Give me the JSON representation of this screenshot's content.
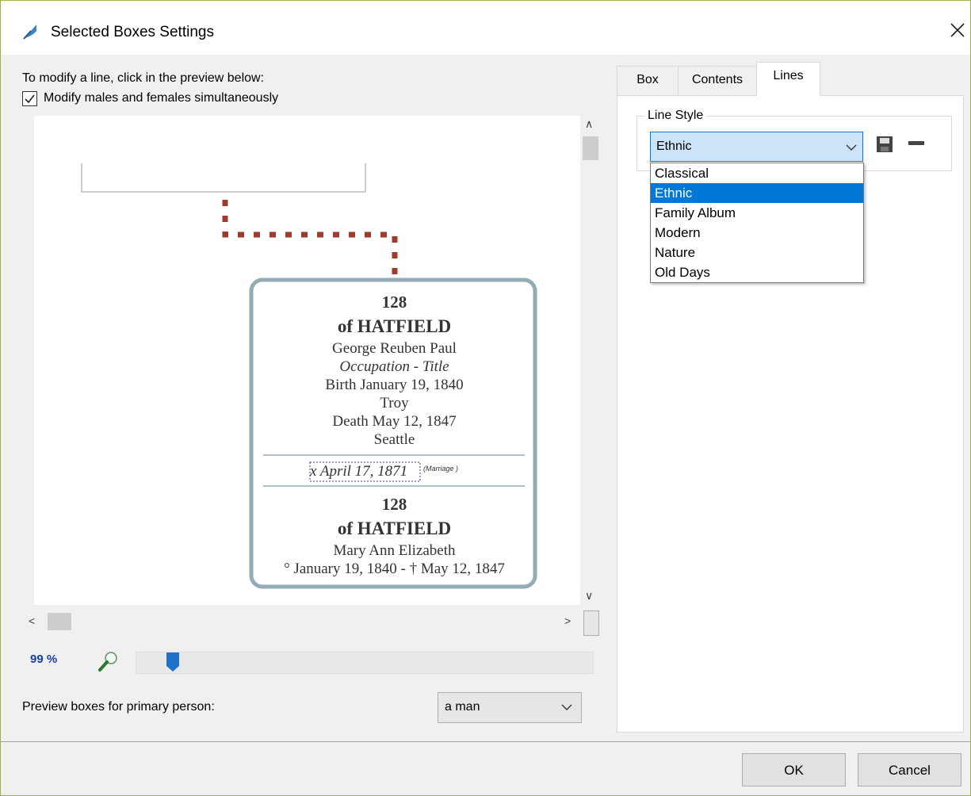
{
  "window": {
    "title": "Selected Boxes Settings"
  },
  "left": {
    "instruction": "To modify a line, click in the preview below:",
    "checkbox": {
      "label": "Modify males and females simultaneously",
      "checked": true
    },
    "zoom": {
      "percent_label": "99 %",
      "level_percent": 8
    },
    "preview_label": "Preview boxes for primary person:",
    "preview_select": {
      "value": "a man"
    }
  },
  "preview_card": {
    "number1": "128",
    "surname1": "of HATFIELD",
    "name1": "George Reuben Paul",
    "occupation": "Occupation - Title",
    "birth": "Birth January 19, 1840",
    "birth_place": "Troy",
    "death": "Death May 12, 1847",
    "death_place": "Seattle",
    "marriage_date": "x April 17, 1871",
    "marriage_tag": "(Marriage )",
    "number2": "128",
    "surname2": "of HATFIELD",
    "name2": "Mary Ann Elizabeth",
    "dates2": "° January 19, 1840  - † May 12, 1847"
  },
  "tabs": [
    {
      "label": "Box"
    },
    {
      "label": "Contents"
    },
    {
      "label": "Lines",
      "active": true
    }
  ],
  "lines": {
    "group_label": "Line Style",
    "combo_value": "Ethnic",
    "options": [
      "Classical",
      "Ethnic",
      "Family Album",
      "Modern",
      "Nature",
      "Old Days"
    ],
    "selected_index": 1
  },
  "buttons": {
    "ok": "OK",
    "cancel": "Cancel"
  },
  "colors": {
    "accent": "#0078d7",
    "line_dash": "#9e3b2e",
    "card_border": "#94abb8",
    "zoom_text": "#1a3ea8"
  }
}
